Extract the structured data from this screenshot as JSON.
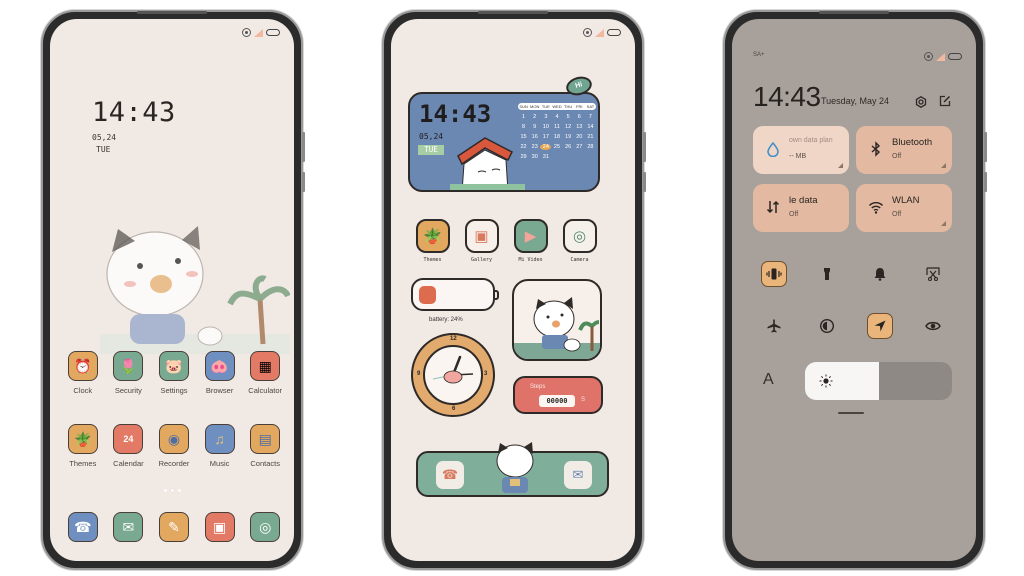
{
  "phones": [
    {
      "name": "home-screen",
      "clock": {
        "time": "14:43",
        "date": "05,24",
        "day": "TUE"
      },
      "apps_row1": [
        {
          "label": "Clock",
          "icon": "alarm-clock-icon",
          "color": "#e2a860",
          "glyph": "⏰"
        },
        {
          "label": "Security",
          "icon": "shield-flower-icon",
          "color": "#7aa992",
          "glyph": "🌷"
        },
        {
          "label": "Settings",
          "icon": "settings-pig-icon",
          "color": "#7aa992",
          "glyph": "🐷"
        },
        {
          "label": "Browser",
          "icon": "browser-pig-icon",
          "color": "#6f8fc0",
          "glyph": "🐽"
        },
        {
          "label": "Calculator",
          "icon": "calculator-icon",
          "color": "#e27a66",
          "glyph": "▦"
        }
      ],
      "apps_row2": [
        {
          "label": "Themes",
          "icon": "plant-pot-icon",
          "color": "#e2a860",
          "glyph": "🪴"
        },
        {
          "label": "Calendar",
          "icon": "calendar-icon",
          "color": "#e27a66",
          "glyph": "24"
        },
        {
          "label": "Recorder",
          "icon": "recorder-icon",
          "color": "#e2a860",
          "glyph": "◉"
        },
        {
          "label": "Music",
          "icon": "music-note-icon",
          "color": "#6f8fc0",
          "glyph": "♫"
        },
        {
          "label": "Contacts",
          "icon": "contacts-book-icon",
          "color": "#e2a860",
          "glyph": "▤"
        }
      ],
      "dock": [
        {
          "icon": "phone-card-icon",
          "color": "#6f8fc0",
          "glyph": "☎"
        },
        {
          "icon": "message-bubble-icon",
          "color": "#7aa992",
          "glyph": "✉"
        },
        {
          "icon": "notes-icon",
          "color": "#e2a860",
          "glyph": "✎"
        },
        {
          "icon": "gallery-icon",
          "color": "#e27a66",
          "glyph": "▣"
        },
        {
          "icon": "camera-icon",
          "color": "#7aa992",
          "glyph": "◎"
        }
      ],
      "page_dots": 3,
      "active_page": 2
    },
    {
      "name": "widget-screen",
      "widget": {
        "time": "14:43",
        "date": "05,24",
        "day": "TUE",
        "greeting": "Hi",
        "weekdays": [
          "SUN",
          "MON",
          "TUE",
          "WED",
          "THU",
          "FRI",
          "SAT"
        ],
        "days": [
          "1",
          "2",
          "3",
          "4",
          "5",
          "6",
          "7",
          "8",
          "9",
          "10",
          "11",
          "12",
          "13",
          "14",
          "15",
          "16",
          "17",
          "18",
          "19",
          "20",
          "21",
          "22",
          "23",
          "24",
          "25",
          "26",
          "27",
          "28",
          "29",
          "30",
          "31"
        ],
        "today": "24"
      },
      "apps": [
        {
          "label": "Themes",
          "icon": "plant-pot-icon",
          "color": "#e2a860",
          "glyph": "🪴"
        },
        {
          "label": "Gallery",
          "icon": "gallery-icon",
          "color": "#e6c28f",
          "glyph": "▣"
        },
        {
          "label": "Mi Video",
          "icon": "video-icon",
          "color": "#7aa992",
          "glyph": "▶"
        },
        {
          "label": "Camera",
          "icon": "camera-icon",
          "color": "#f6f0eb",
          "glyph": "◎"
        }
      ],
      "battery": {
        "label": "battery: 24%",
        "percent": 24
      },
      "clock_numbers": [
        "12",
        "3",
        "6",
        "9"
      ],
      "steps": {
        "label": "Steps",
        "count": "00000",
        "unit": "S"
      }
    },
    {
      "name": "control-center",
      "carrier": "SA+",
      "time": "14:43",
      "date": "Tuesday, May 24",
      "tiles": [
        {
          "title": "own data plan",
          "sub": "-- MB",
          "icon": "water-drop-icon"
        },
        {
          "title": "Bluetooth",
          "sub": "Off",
          "icon": "bluetooth-icon"
        },
        {
          "title": "le data",
          "sub": "Off",
          "icon": "mobile-data-icon"
        },
        {
          "title": "WLAN",
          "sub": "Off",
          "icon": "wifi-icon"
        }
      ],
      "toggles_row1": [
        {
          "icon": "vibrate-icon",
          "active": true
        },
        {
          "icon": "flashlight-icon",
          "active": false
        },
        {
          "icon": "bell-icon",
          "active": false
        },
        {
          "icon": "screenshot-icon",
          "active": false
        }
      ],
      "toggles_row2": [
        {
          "icon": "airplane-icon",
          "active": false
        },
        {
          "icon": "dark-mode-icon",
          "active": false
        },
        {
          "icon": "location-icon",
          "active": true
        },
        {
          "icon": "eye-comfort-icon",
          "active": false
        }
      ],
      "font_label": "A",
      "brightness": 0.5
    }
  ]
}
